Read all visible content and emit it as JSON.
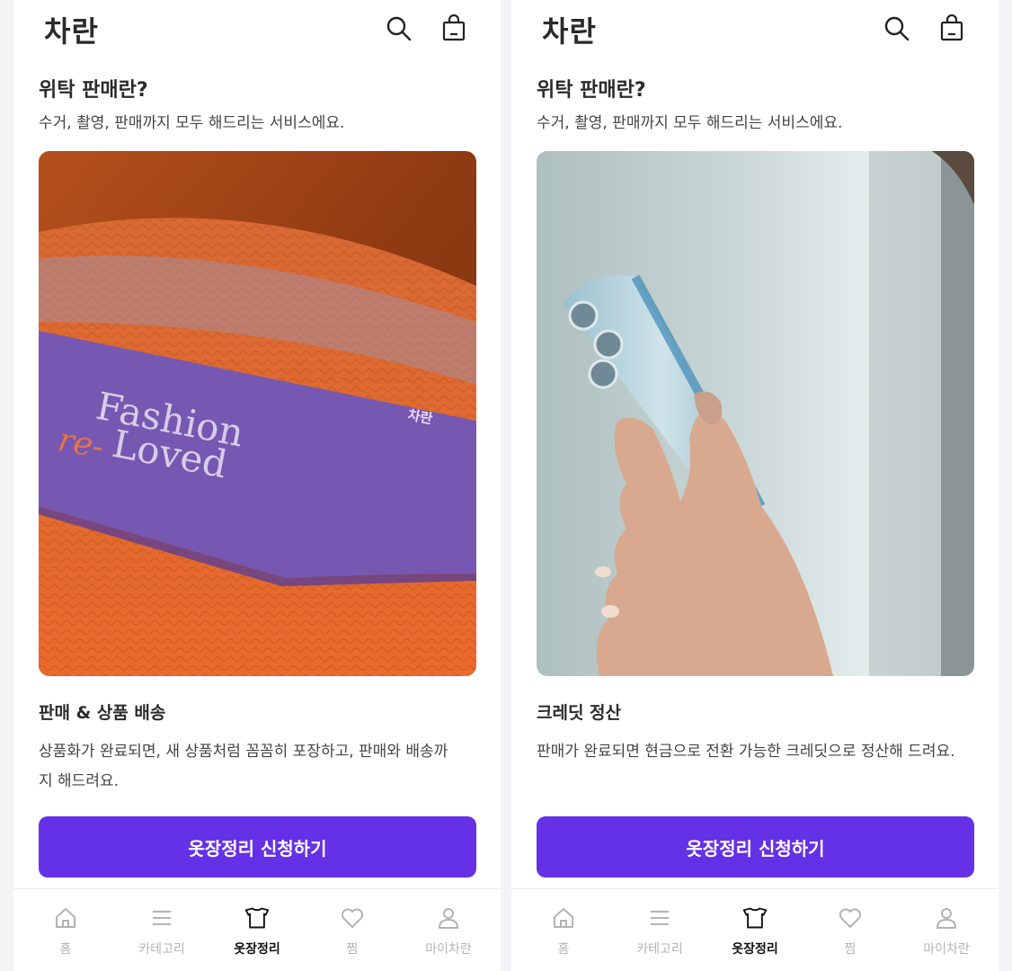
{
  "screens": [
    {
      "header": {
        "logo": "차란"
      },
      "intro": {
        "title": "위탁 판매란?",
        "desc": "수거, 촬영, 판매까지 모두 해드리는 서비스에요."
      },
      "photo": {
        "card_brand": "차란",
        "card_line1": "Fashion",
        "card_line2_prefix": "re-",
        "card_line2": "Loved"
      },
      "card": {
        "title": "판매 & 상품 배송",
        "desc": "상품화가 완료되면, 새 상품처럼 꼼꼼히 포장하고, 판매와 배송까지 해드려요."
      },
      "cta": "옷장정리 신청하기"
    },
    {
      "header": {
        "logo": "차란"
      },
      "intro": {
        "title": "위탁 판매란?",
        "desc": "수거, 촬영, 판매까지 모두 해드리는 서비스에요."
      },
      "card": {
        "title": "크레딧 정산",
        "desc": "판매가 완료되면 현금으로 전환 가능한 크레딧으로 정산해 드려요."
      },
      "cta": "옷장정리 신청하기"
    }
  ],
  "tabbar": [
    {
      "label": "홈",
      "icon": "home-icon",
      "active": false
    },
    {
      "label": "카테고리",
      "icon": "menu-icon",
      "active": false
    },
    {
      "label": "옷장정리",
      "icon": "closet-icon",
      "active": true
    },
    {
      "label": "찜",
      "icon": "heart-icon",
      "active": false
    },
    {
      "label": "마이차란",
      "icon": "user-icon",
      "active": false
    }
  ],
  "colors": {
    "accent": "#6531e6",
    "tab_inactive": "#b3b3b3",
    "tab_active": "#111111"
  }
}
